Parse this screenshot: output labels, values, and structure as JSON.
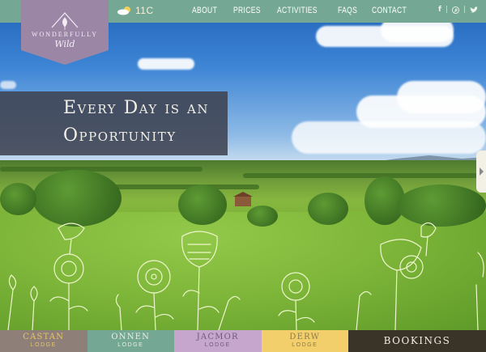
{
  "brand": {
    "wordmark": "WONDERFULLY",
    "script": "Wild",
    "color": "#9c86a6"
  },
  "weather": {
    "temperature": "11C",
    "icon": "sun-cloud-icon"
  },
  "nav": {
    "items": [
      {
        "label": "ABOUT"
      },
      {
        "label": "PRICES"
      },
      {
        "label": "ACTIVITIES"
      },
      {
        "label": "FAQS"
      },
      {
        "label": "CONTACT"
      }
    ],
    "bar_color": "#75a894"
  },
  "social": {
    "facebook": "f",
    "pinterest": "pinterest-icon",
    "twitter": "twitter-icon",
    "separator": "|"
  },
  "hero": {
    "headline_line1": "Every Day is an",
    "headline_line2": "Opportunity"
  },
  "lodges": [
    {
      "name": "CASTAN",
      "sub": "LODGE",
      "bg": "#8e8078",
      "fg": "#e8c56a"
    },
    {
      "name": "ONNEN",
      "sub": "LODGE",
      "bg": "#75a894",
      "fg": "#e9efe6"
    },
    {
      "name": "JACMOR",
      "sub": "LODGE",
      "bg": "#c6a6cc",
      "fg": "#6f5a7d"
    },
    {
      "name": "DERW",
      "sub": "LODGE",
      "bg": "#f3cf6b",
      "fg": "#8a7a4e"
    }
  ],
  "bookings": {
    "label": "BOOKINGS",
    "bg": "#3a3328"
  }
}
